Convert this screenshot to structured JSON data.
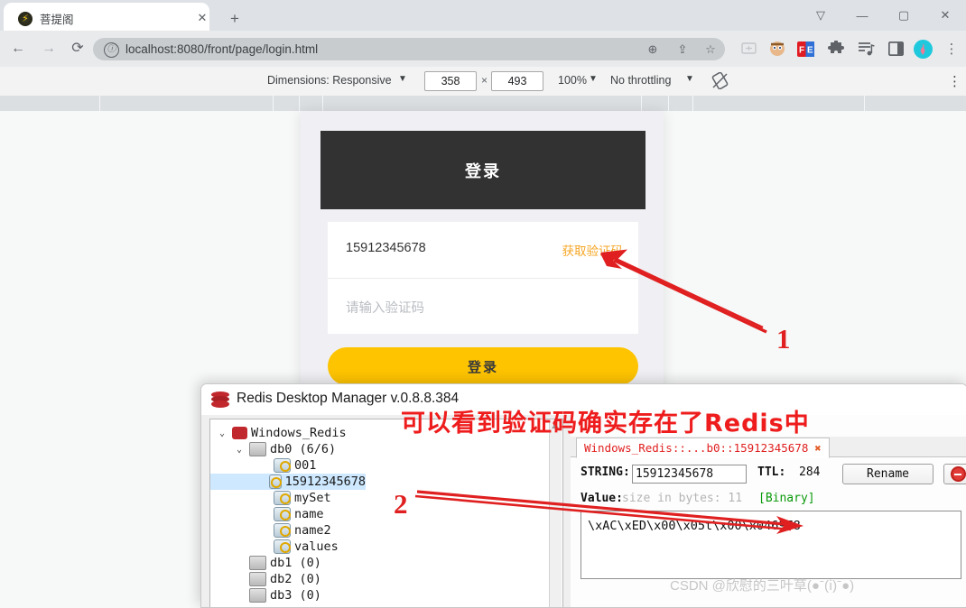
{
  "browser": {
    "tab": {
      "title": "菩提阁",
      "favicon": "lightning-icon",
      "close": "✕"
    },
    "new_tab": "+",
    "window_controls": {
      "minimize": "—",
      "maximize": "▢",
      "close": "✕",
      "extra": "▽"
    },
    "nav": {
      "back": "←",
      "forward": "→",
      "reload": "⟳"
    },
    "omnibox": {
      "info_icon": "ⓘ",
      "url": "localhost:8080/front/page/login.html",
      "zoom_icon": "⊕",
      "share_icon": "⇪",
      "bookmark_icon": "☆"
    },
    "extensions": [
      "cast-icon",
      "avatar-extension-icon",
      "fe-extension-icon",
      "puzzle-icon",
      "reading-list-icon",
      "sidepanel-icon",
      "profile-avatar",
      "kebab-menu-icon"
    ]
  },
  "device_toolbar": {
    "dimensions_label": "Dimensions: Responsive",
    "dimensions_caret": "▼",
    "width_value": "358",
    "times": "×",
    "height_value": "493",
    "zoom_value": "100%",
    "zoom_caret": "▼",
    "throttling_value": "No throttling",
    "throttling_caret": "▼",
    "rotate_icon": "rotate-icon",
    "more_icon": "⋮"
  },
  "login_page": {
    "header_title": "登录",
    "phone_value": "15912345678",
    "get_code_label": "获取验证码",
    "code_placeholder": "请输入验证码",
    "submit_label": "登录",
    "accent_color": "#fec400",
    "header_color": "#323232"
  },
  "annotations": {
    "marker_one": "1",
    "marker_two": "2",
    "red_note": "可以看到验证码确实存在了Redis中",
    "arrow_color": "#e02020"
  },
  "redis": {
    "window_title": "Redis Desktop Manager v.0.8.8.384",
    "tree": [
      {
        "label": "Windows_Redis",
        "icon": "redis-icon",
        "indent": 0,
        "chevron": "⌄",
        "selected": false
      },
      {
        "label": "db0  (6/6)",
        "icon": "db-icon",
        "indent": 1,
        "chevron": "⌄",
        "selected": false
      },
      {
        "label": "001",
        "icon": "key-icon",
        "indent": 2,
        "chevron": "",
        "selected": false
      },
      {
        "label": "15912345678",
        "icon": "key-icon",
        "indent": 2,
        "chevron": "",
        "selected": true
      },
      {
        "label": "mySet",
        "icon": "key-icon",
        "indent": 2,
        "chevron": "",
        "selected": false
      },
      {
        "label": "name",
        "icon": "key-icon",
        "indent": 2,
        "chevron": "",
        "selected": false
      },
      {
        "label": "name2",
        "icon": "key-icon",
        "indent": 2,
        "chevron": "",
        "selected": false
      },
      {
        "label": "values",
        "icon": "key-icon",
        "indent": 2,
        "chevron": "",
        "selected": false
      },
      {
        "label": "db1  (0)",
        "icon": "db-icon",
        "indent": 1,
        "chevron": "",
        "selected": false
      },
      {
        "label": "db2  (0)",
        "icon": "db-icon",
        "indent": 1,
        "chevron": "",
        "selected": false
      },
      {
        "label": "db3  (0)",
        "icon": "db-icon",
        "indent": 1,
        "chevron": "",
        "selected": false
      }
    ],
    "key_tab": {
      "label": "Windows_Redis::...b0::15912345678",
      "close": "✖"
    },
    "detail": {
      "type_label": "STRING:",
      "key_value": "15912345678",
      "ttl_label": "TTL:",
      "ttl_value": "284",
      "rename_label": "Rename",
      "delete_icon": "delete-circle-icon",
      "value_label": "Value:",
      "size_text": "size in bytes: 11",
      "binary_tag": "[Binary]",
      "value_content": "\\xAC\\xED\\x00\\x05t\\x00\\x046978"
    }
  },
  "watermark": "CSDN @欣慰的三叶草(●ˉ(ⅰ)ˉ●)"
}
